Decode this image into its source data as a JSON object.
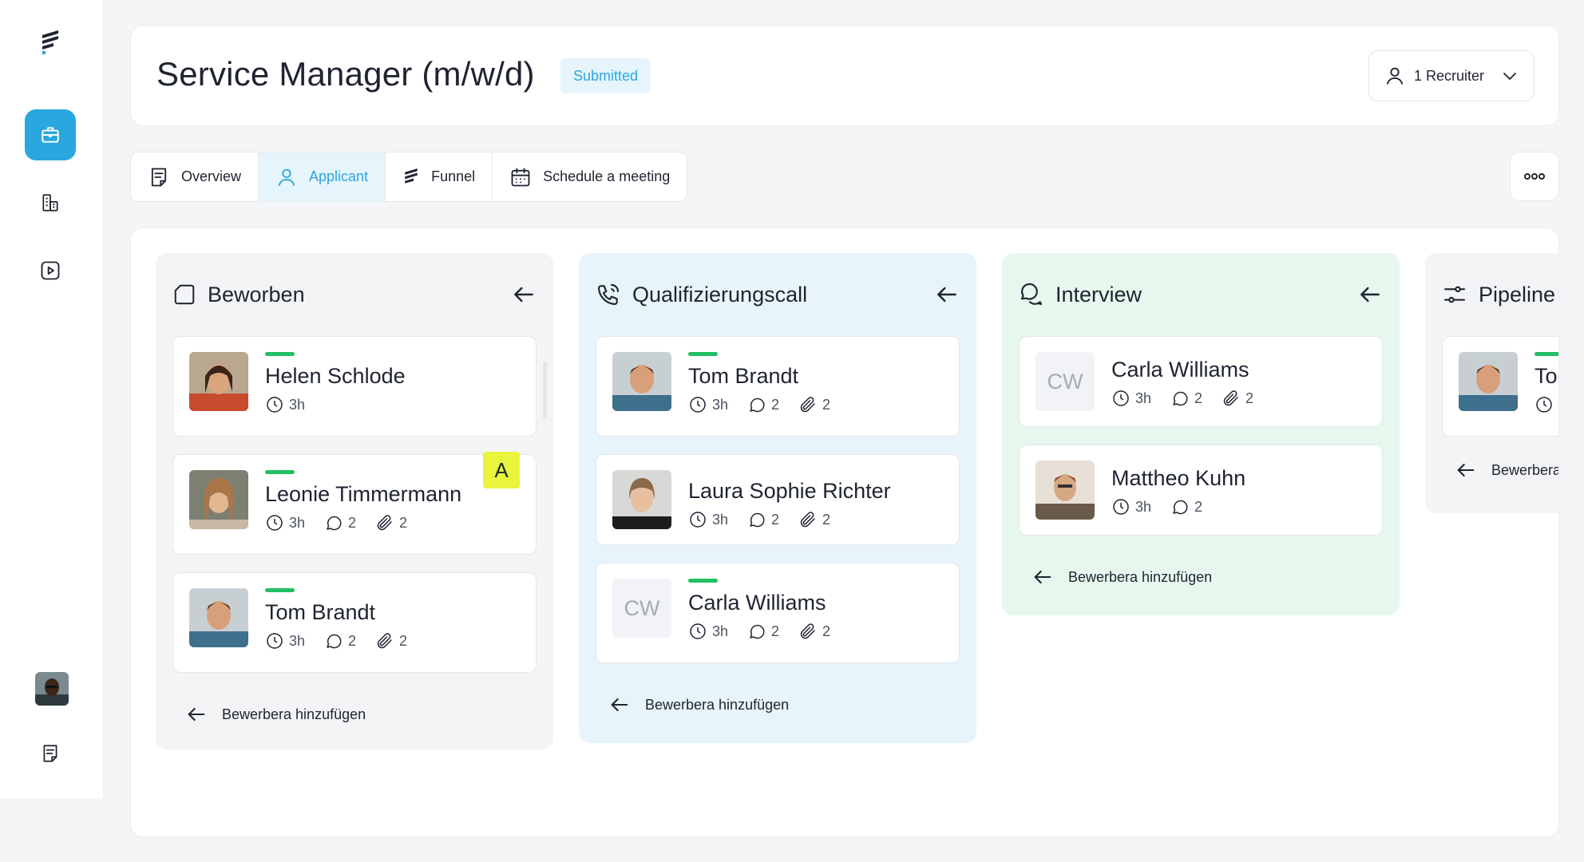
{
  "job": {
    "title": "Service Manager (m/w/d)",
    "status": "Submitted",
    "recruiter_label": "1 Recruiter"
  },
  "tabs": [
    {
      "label": "Overview",
      "icon": "document-icon"
    },
    {
      "label": "Applicant",
      "icon": "user-icon",
      "active": true
    },
    {
      "label": "Funnel",
      "icon": "funnel-logo-icon"
    },
    {
      "label": "Schedule a meeting",
      "icon": "calendar-icon"
    }
  ],
  "colors": {
    "accent": "#2aa7df",
    "qualification_bg": "#e8f4fb",
    "interview_bg": "#e6f7ee",
    "beworben_bg": "#f3f4f6",
    "green": "#22c063",
    "badge_yellow": "#e8f53c"
  },
  "columns": [
    {
      "title": "Beworben",
      "icon": "square-icon",
      "add_label": "Bewerbera hinzufügen",
      "cards": [
        {
          "name": "Helen Schlode",
          "time": "3h",
          "comments": "",
          "attachments": ""
        },
        {
          "name": "Leonie Timmermann",
          "time": "3h",
          "comments": "2",
          "attachments": "2",
          "badge": "A"
        },
        {
          "name": "Tom Brandt",
          "time": "3h",
          "comments": "2",
          "attachments": "2"
        }
      ]
    },
    {
      "title": "Qualifizierungscall",
      "icon": "phone-icon",
      "add_label": "Bewerbera hinzufügen",
      "cards": [
        {
          "name": "Tom Brandt",
          "time": "3h",
          "comments": "2",
          "attachments": "2"
        },
        {
          "name": "Laura Sophie Richter",
          "time": "3h",
          "comments": "2",
          "attachments": "2"
        },
        {
          "name": "Carla Williams",
          "initials": "CW",
          "time": "3h",
          "comments": "2",
          "attachments": "2"
        }
      ]
    },
    {
      "title": "Interview",
      "icon": "chat-icon",
      "add_label": "Bewerbera hinzufügen",
      "cards": [
        {
          "name": "Carla Williams",
          "initials": "CW",
          "time": "3h",
          "comments": "2",
          "attachments": "2"
        },
        {
          "name": "Mattheo Kuhn",
          "time": "3h",
          "comments": "2"
        }
      ]
    },
    {
      "title": "Pipeline",
      "icon": "sliders-icon",
      "add_label": "Bewerbera",
      "cards": [
        {
          "name": "To"
        }
      ]
    }
  ]
}
